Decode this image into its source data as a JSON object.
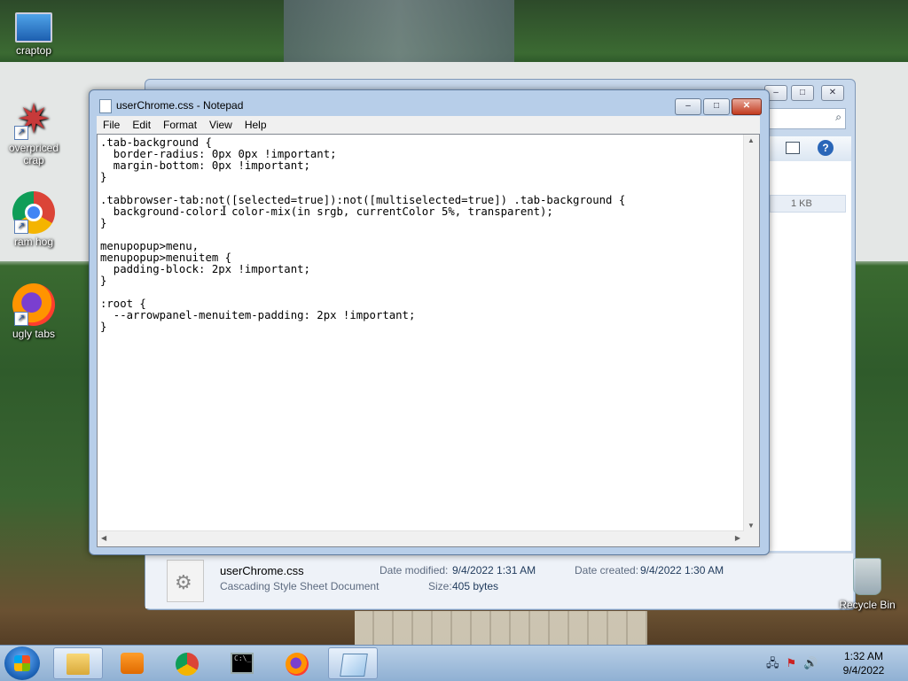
{
  "desktop": {
    "icons": [
      {
        "label": "craptop",
        "icon": "computer-icon"
      },
      {
        "label": "overpriced crap",
        "icon": "mathematica-icon"
      },
      {
        "label": "ram hog",
        "icon": "chrome-icon"
      },
      {
        "label": "ugly tabs",
        "icon": "firefox-icon"
      }
    ],
    "recycle_bin": "Recycle Bin"
  },
  "notepad": {
    "title": "userChrome.css - Notepad",
    "controls": {
      "minimize": "–",
      "maximize": "□",
      "close": "✕"
    },
    "menu": [
      "File",
      "Edit",
      "Format",
      "View",
      "Help"
    ],
    "content": ".tab-background {\n  border-radius: 0px 0px !important;\n  margin-bottom: 0px !important;\n}\n\n.tabbrowser-tab:not([selected=true]):not([multiselected=true]) .tab-background {\n  background-color: color-mix(in srgb, currentColor 5%, transparent);\n}\n\nmenupopup>menu,\nmenupopup>menuitem {\n  padding-block: 2px !important;\n}\n\n:root {\n  --arrowpanel-menuitem-padding: 2px !important;\n}"
  },
  "explorer": {
    "size_cell": "1 KB",
    "details": {
      "file_name": "userChrome.css",
      "file_type": "Cascading Style Sheet Document",
      "date_modified_label": "Date modified:",
      "date_modified": "9/4/2022 1:31 AM",
      "date_created_label": "Date created:",
      "date_created": "9/4/2022 1:30 AM",
      "size_label": "Size:",
      "size": "405 bytes"
    }
  },
  "taskbar": {
    "pinned": [
      "explorer-icon",
      "media-player-icon",
      "chrome-icon",
      "cmd-icon",
      "firefox-icon",
      "notepad-icon"
    ],
    "clock": {
      "time": "1:32 AM",
      "date": "9/4/2022"
    }
  }
}
